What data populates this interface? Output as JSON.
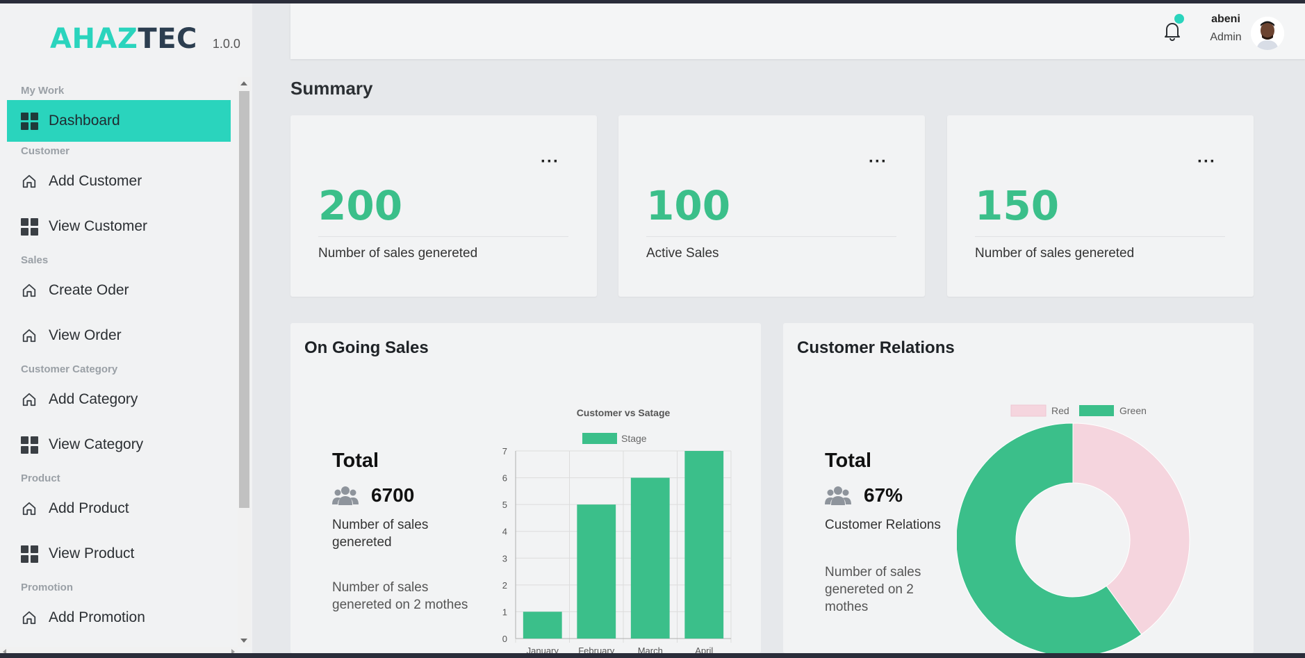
{
  "sidebar": {
    "brand_part1": "AHAZ",
    "brand_part2": "TEC",
    "version": "1.0.0",
    "sections": {
      "my_work": "My Work",
      "customer": "Customer",
      "sales": "Sales",
      "customer_category": "Customer Category",
      "product": "Product",
      "promotion": "Promotion"
    },
    "items": {
      "dashboard": "Dashboard",
      "add_customer": "Add Customer",
      "view_customer": "View Customer",
      "create_oder": "Create Oder",
      "view_order": "View Order",
      "add_category": "Add Category",
      "view_category": "View Category",
      "add_product": "Add Product",
      "view_product": "View Product",
      "add_promotion": "Add Promotion"
    }
  },
  "header": {
    "user_name": "abeni",
    "user_role": "Admin"
  },
  "summary": {
    "title": "Summary",
    "cards": [
      {
        "value": "200",
        "label": "Number of sales genereted",
        "menu": "···"
      },
      {
        "value": "100",
        "label": "Active Sales",
        "menu": "···"
      },
      {
        "value": "150",
        "label": "Number of sales genereted",
        "menu": "···"
      }
    ]
  },
  "ongoing": {
    "title": "On Going Sales",
    "total_label": "Total",
    "total_value": "6700",
    "desc1": "Number of sales genereted",
    "desc2": "Number of sales genereted on 2 mothes"
  },
  "relations": {
    "title": "Customer Relations",
    "total_label": "Total",
    "total_value": "67%",
    "desc1": "Customer Relations",
    "desc2": "Number of sales genereted on 2 mothes"
  },
  "colors": {
    "accent": "#2ad4bd",
    "green": "#3bbf8a",
    "pink": "#f5d5de"
  },
  "chart_data": [
    {
      "type": "bar",
      "title": "Customer vs Satage",
      "categories": [
        "January",
        "February",
        "March",
        "April"
      ],
      "series": [
        {
          "name": "Stage",
          "values": [
            1,
            5,
            6,
            7
          ]
        }
      ],
      "ylim": [
        0,
        7
      ],
      "yticks": [
        "0",
        "1",
        "2",
        "3",
        "4",
        "5",
        "6",
        "7"
      ],
      "grid": true,
      "legend": "top"
    },
    {
      "type": "pie",
      "labels": [
        "Red",
        "Green"
      ],
      "values": [
        40,
        60
      ],
      "colors": [
        "#f5d5de",
        "#3bbf8a"
      ],
      "legend": "top"
    }
  ]
}
